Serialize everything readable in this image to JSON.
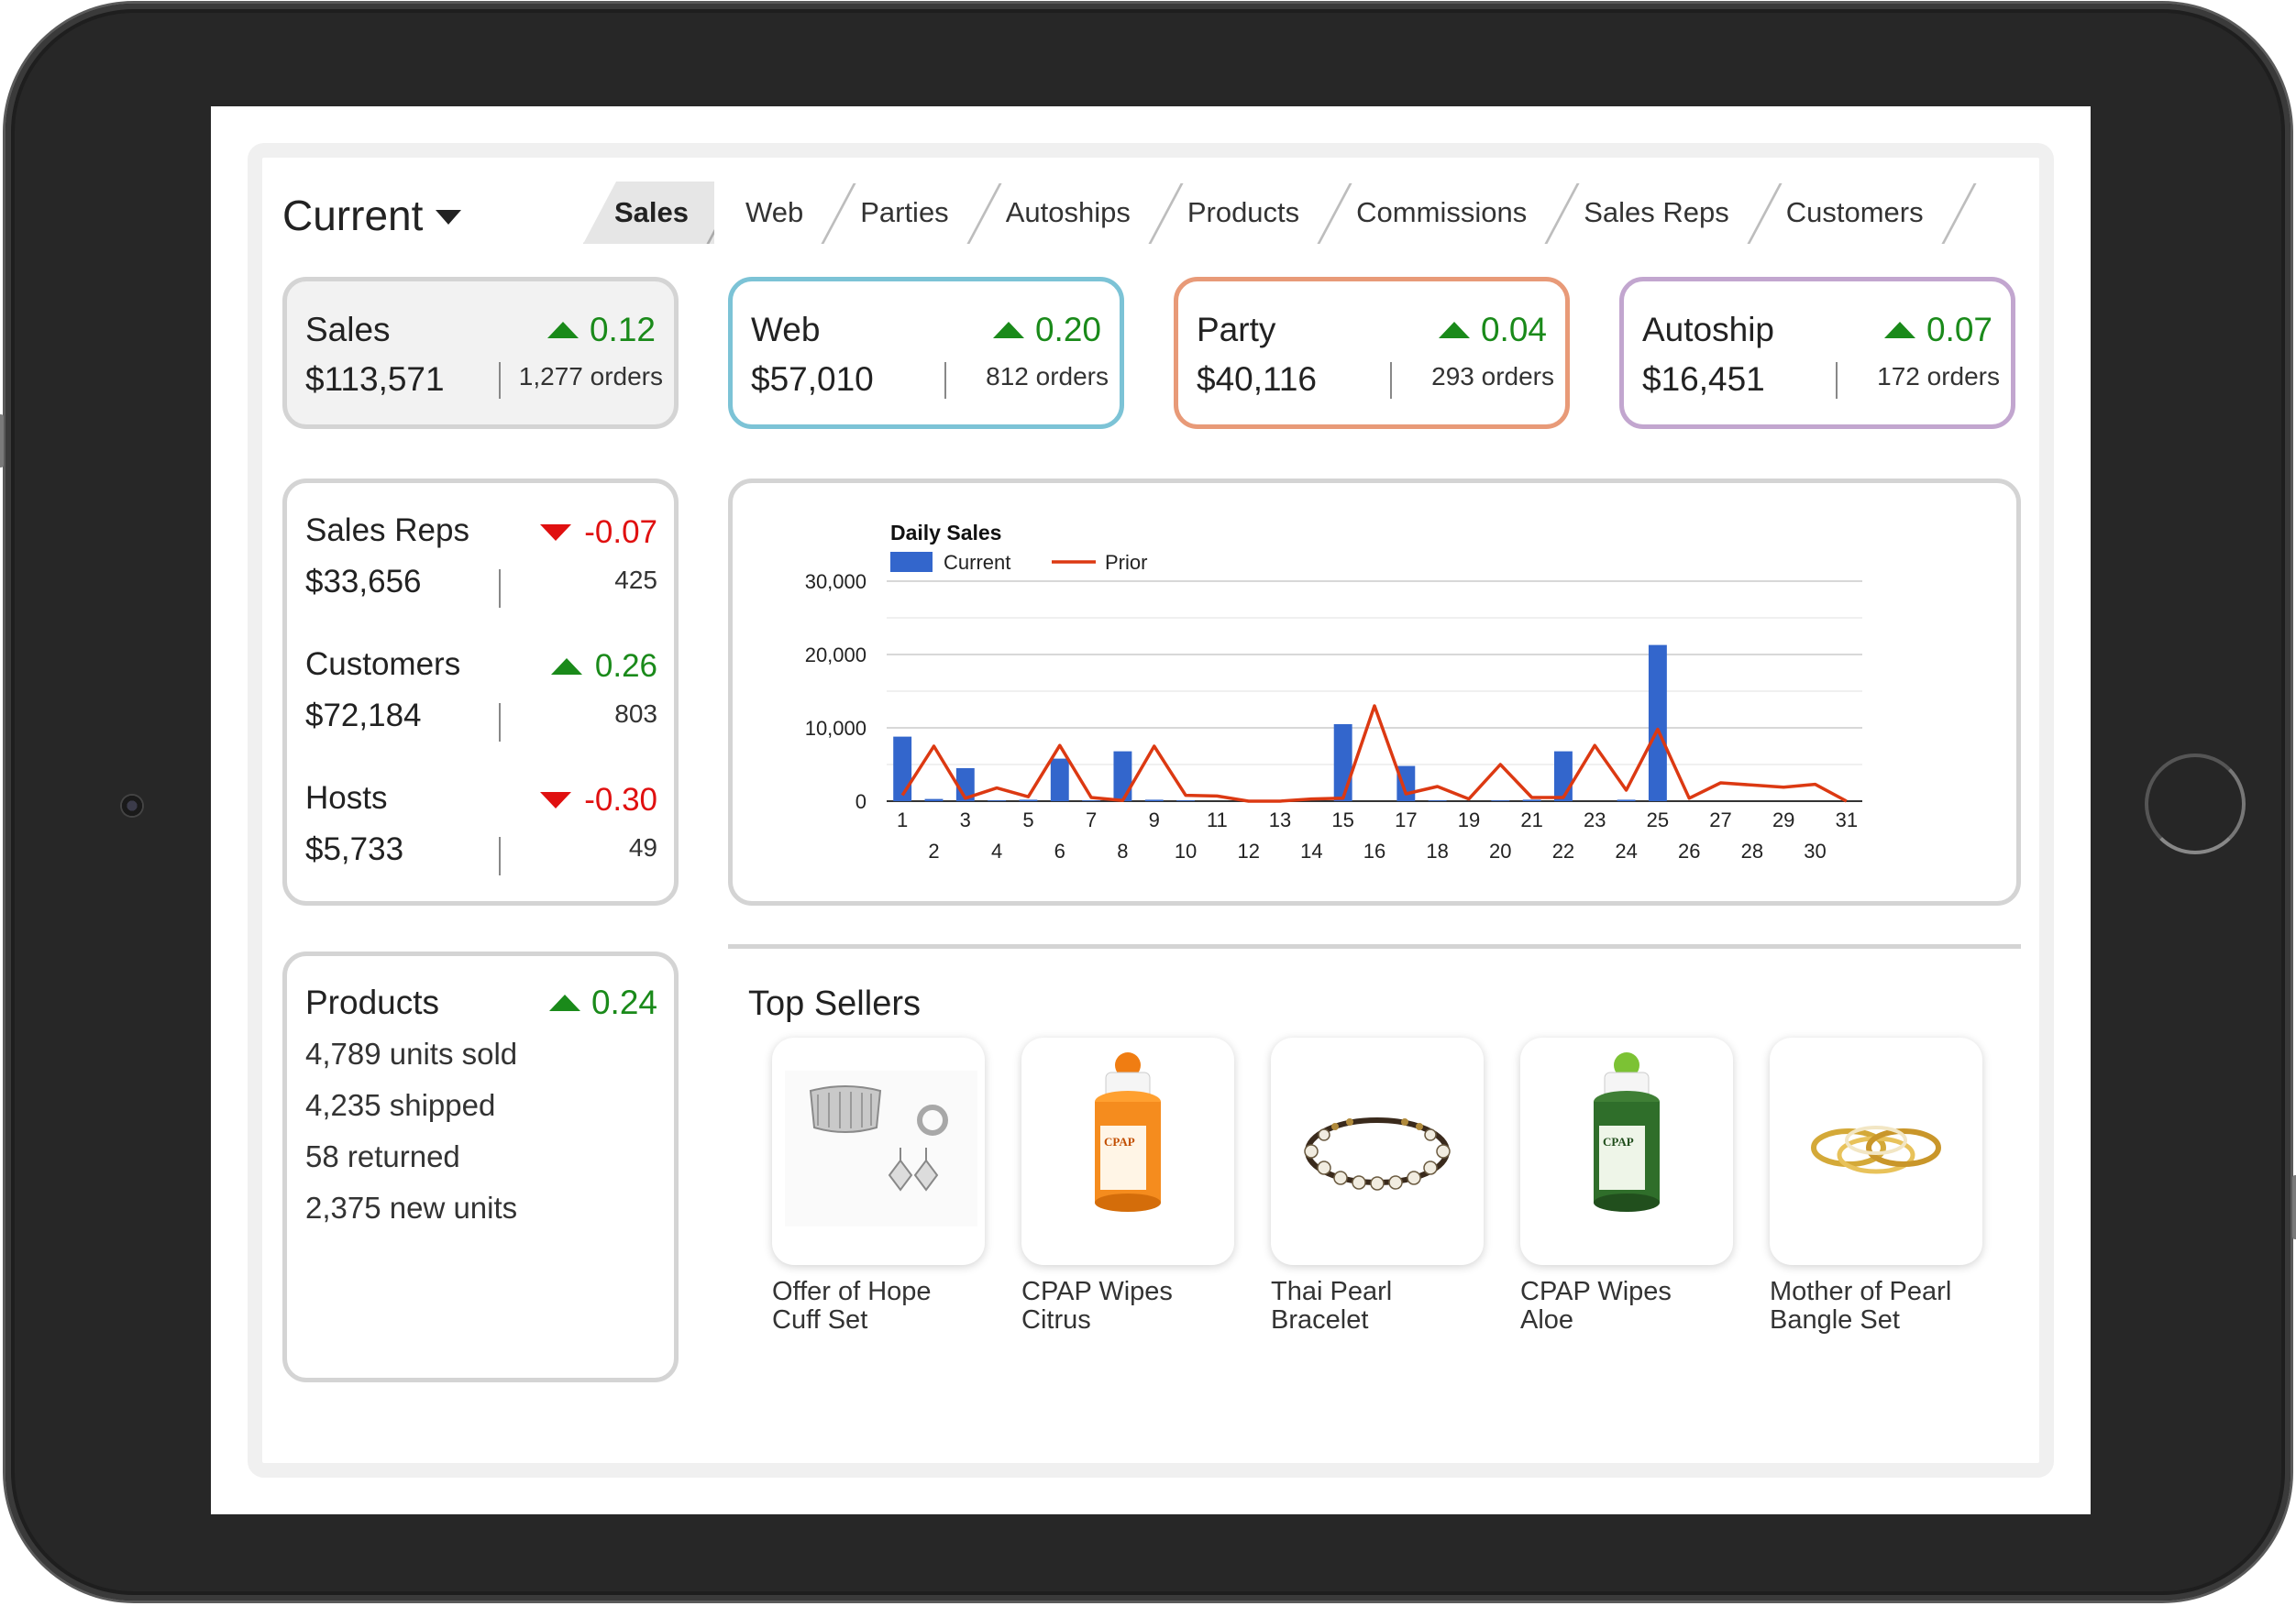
{
  "period": {
    "label": "Current"
  },
  "tabs": [
    {
      "label": "Sales",
      "active": true
    },
    {
      "label": "Web"
    },
    {
      "label": "Parties"
    },
    {
      "label": "Autoships"
    },
    {
      "label": "Products"
    },
    {
      "label": "Commissions"
    },
    {
      "label": "Sales Reps"
    },
    {
      "label": "Customers"
    }
  ],
  "kpis": [
    {
      "name": "Sales",
      "delta": "0.12",
      "direction": "up",
      "amount": "$113,571",
      "orders": "1,277 orders",
      "border_color": "#d4d4d4",
      "background": "#f2f2f2"
    },
    {
      "name": "Web",
      "delta": "0.20",
      "direction": "up",
      "amount": "$57,010",
      "orders": "812 orders",
      "border_color": "#7cc3d6",
      "background": "#ffffff"
    },
    {
      "name": "Party",
      "delta": "0.04",
      "direction": "up",
      "amount": "$40,116",
      "orders": "293 orders",
      "border_color": "#e89a78",
      "background": "#ffffff"
    },
    {
      "name": "Autoship",
      "delta": "0.07",
      "direction": "up",
      "amount": "$16,451",
      "orders": "172 orders",
      "border_color": "#c2a6cf",
      "background": "#ffffff"
    }
  ],
  "stats": [
    {
      "name": "Sales Reps",
      "delta": "-0.07",
      "direction": "down",
      "amount": "$33,656",
      "count": "425"
    },
    {
      "name": "Customers",
      "delta": "0.26",
      "direction": "up",
      "amount": "$72,184",
      "count": "803"
    },
    {
      "name": "Hosts",
      "delta": "-0.30",
      "direction": "down",
      "amount": "$5,733",
      "count": "49"
    }
  ],
  "products_card": {
    "name": "Products",
    "delta": "0.24",
    "lines": [
      "4,789 units sold",
      "4,235 shipped",
      "58 returned",
      "2,375 new units"
    ]
  },
  "colors": {
    "positive": "#1a8a1a",
    "negative": "#e01010",
    "current_series": "#3366cc",
    "prior_series": "#dc3912"
  },
  "chart_data": {
    "type": "bar",
    "title": "Daily Sales",
    "ylim": [
      0,
      30000
    ],
    "yticks": [
      "30,000",
      "20,000",
      "10,000",
      "0"
    ],
    "ytick_values": [
      30000,
      20000,
      10000,
      0
    ],
    "x": [
      1,
      2,
      3,
      4,
      5,
      6,
      7,
      8,
      9,
      10,
      11,
      12,
      13,
      14,
      15,
      16,
      17,
      18,
      19,
      20,
      21,
      22,
      23,
      24,
      25,
      26,
      27,
      28,
      29,
      30,
      31
    ],
    "series": [
      {
        "name": "Current",
        "kind": "bar",
        "color": "#3366cc",
        "values": [
          8800,
          300,
          4500,
          100,
          200,
          5800,
          100,
          6800,
          200,
          100,
          0,
          0,
          0,
          0,
          10500,
          0,
          4800,
          100,
          0,
          100,
          200,
          6800,
          0,
          200,
          21300,
          0,
          0,
          0,
          0,
          0,
          0
        ]
      },
      {
        "name": "Prior",
        "kind": "line",
        "color": "#dc3912",
        "values": [
          800,
          7500,
          400,
          1800,
          600,
          7600,
          500,
          100,
          7500,
          800,
          700,
          0,
          0,
          300,
          400,
          13000,
          1000,
          2000,
          300,
          5000,
          500,
          500,
          7600,
          1500,
          9800,
          400,
          2500,
          2200,
          1900,
          2300,
          0
        ]
      }
    ],
    "legend": "top-left",
    "grid": true
  },
  "top_sellers": {
    "title": "Top Sellers",
    "items": [
      {
        "name_line1": "Offer of Hope",
        "name_line2": "Cuff Set",
        "icon": "cuff-jewelry-icon"
      },
      {
        "name_line1": "CPAP Wipes",
        "name_line2": "Citrus",
        "icon": "wipes-canister-orange-icon"
      },
      {
        "name_line1": "Thai Pearl",
        "name_line2": "Bracelet",
        "icon": "pearl-bracelet-icon"
      },
      {
        "name_line1": "CPAP Wipes",
        "name_line2": "Aloe",
        "icon": "wipes-canister-green-icon"
      },
      {
        "name_line1": "Mother of Pearl",
        "name_line2": "Bangle Set",
        "icon": "gold-bangles-icon"
      }
    ]
  }
}
